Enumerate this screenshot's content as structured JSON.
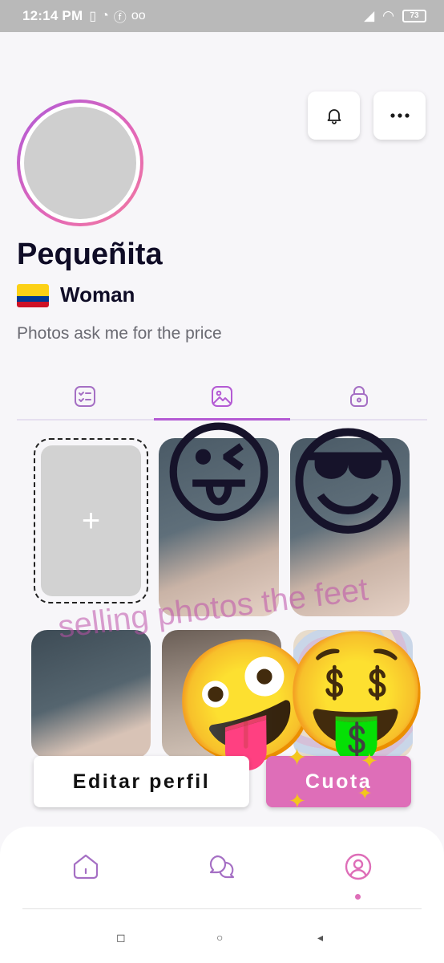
{
  "status_bar": {
    "time": "12:14 PM",
    "battery": "73"
  },
  "profile": {
    "name": "Pequeñita",
    "gender": "Woman",
    "bio": "Photos ask me for the price",
    "country_flag": "colombia-flag"
  },
  "tabs": [
    {
      "icon": "checklist-icon",
      "active": false
    },
    {
      "icon": "gallery-icon",
      "active": true
    },
    {
      "icon": "lock-icon",
      "active": false
    }
  ],
  "gallery": {
    "add_label": "+",
    "watermark_text": "selling photos the feet"
  },
  "actions": {
    "edit_label": "Editar perfil",
    "cuota_label": "Cuota"
  },
  "bottom_nav": [
    {
      "icon": "home-icon",
      "active": false
    },
    {
      "icon": "chat-icon",
      "active": false
    },
    {
      "icon": "profile-icon",
      "active": true
    }
  ],
  "colors": {
    "accent": "#b45ad4",
    "pink": "#de6eb8",
    "status_bar": "#b9b9b9"
  }
}
